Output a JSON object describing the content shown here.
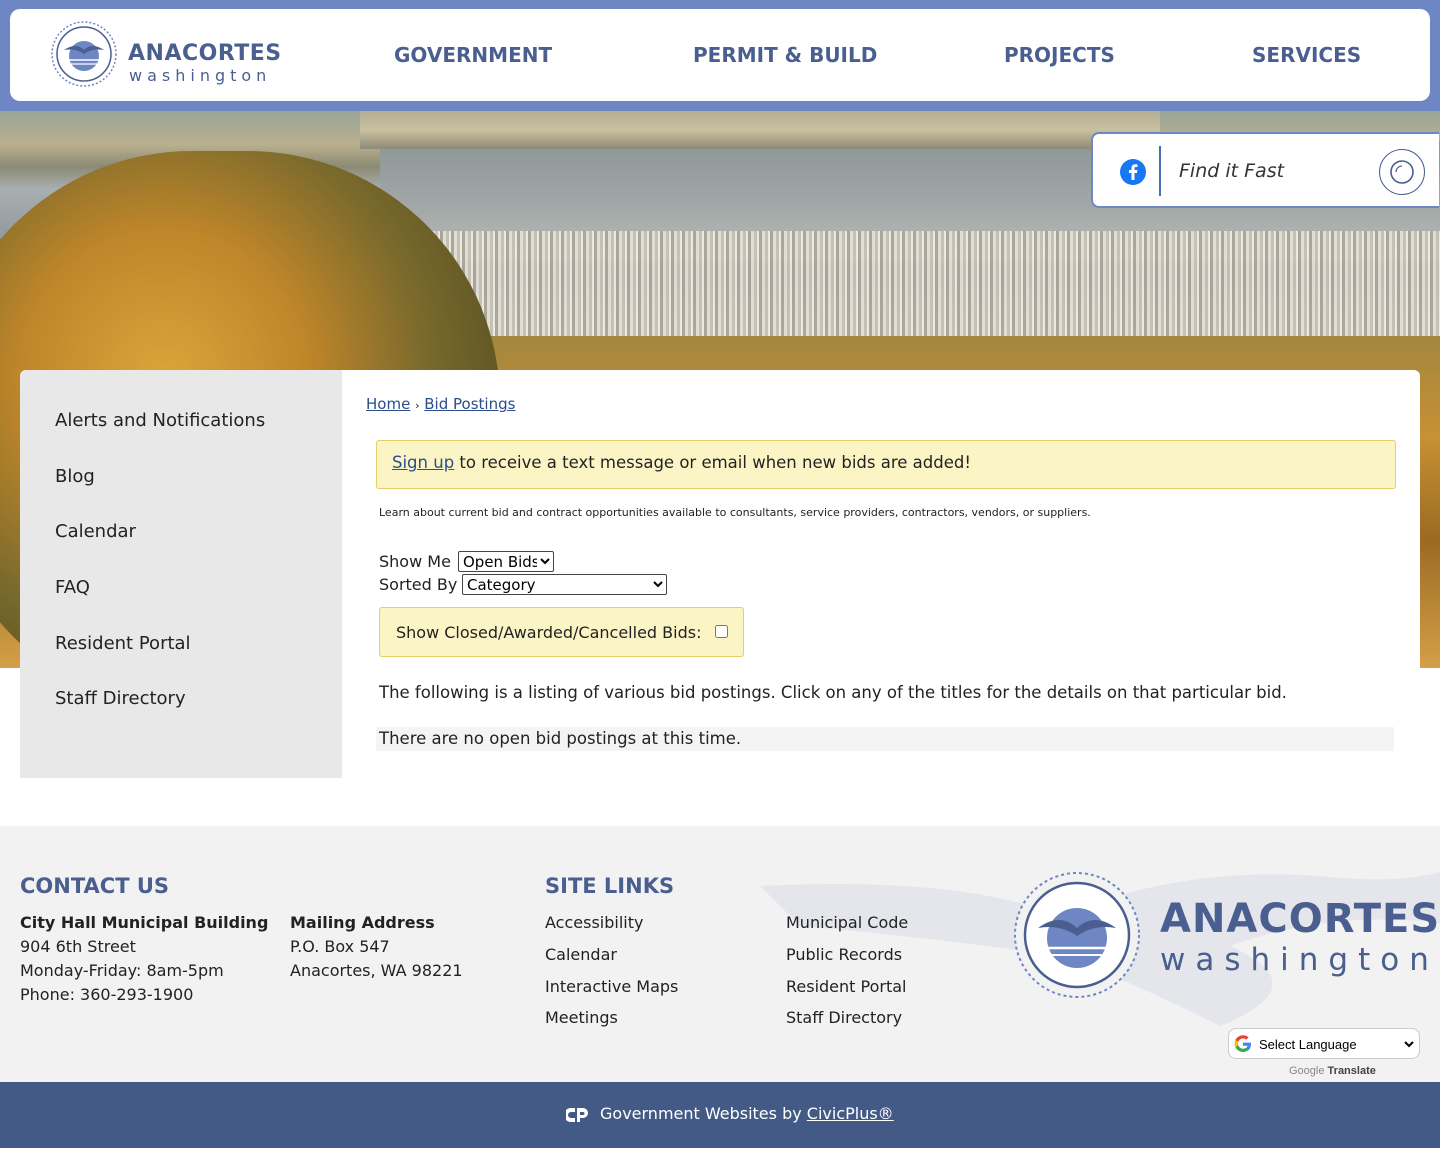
{
  "header": {
    "logo_title": "ANACORTES",
    "logo_sub": "washington",
    "nav": [
      "GOVERNMENT",
      "PERMIT & BUILD",
      "PROJECTS",
      "SERVICES"
    ]
  },
  "search": {
    "placeholder": "Find it Fast"
  },
  "sidebar": {
    "items": [
      "Alerts and Notifications",
      "Blog",
      "Calendar",
      "FAQ",
      "Resident Portal",
      "Staff Directory"
    ]
  },
  "breadcrumb": {
    "home": "Home",
    "sep": "›",
    "current": "Bid Postings"
  },
  "notice": {
    "link": "Sign up",
    "text": " to receive a text message or email when new bids are added!"
  },
  "description": "Learn about current bid and contract opportunities available to consultants, service providers, contractors, vendors, or suppliers.",
  "filters": {
    "show_label": "Show Me",
    "show_value": "Open Bids",
    "sort_label": "Sorted By",
    "sort_value": "Category",
    "closed_label": "Show Closed/Awarded/Cancelled Bids:"
  },
  "listing_text": "The following is a listing of various bid postings. Click on any of the titles for the details on that particular bid.",
  "no_postings": "There are no open bid postings at this time.",
  "footer": {
    "contact_heading": "CONTACT US",
    "city_hall": {
      "title": "City Hall Municipal Building",
      "street": "904 6th Street",
      "hours": "Monday-Friday: 8am-5pm",
      "phone": "Phone: 360-293-1900"
    },
    "mailing": {
      "title": "Mailing Address",
      "box": "P.O. Box 547",
      "city": "Anacortes, WA 98221"
    },
    "links_heading": "SITE LINKS",
    "links_col1": [
      "Accessibility",
      "Calendar",
      "Interactive Maps",
      "Meetings"
    ],
    "links_col2": [
      "Municipal Code",
      "Public Records",
      "Resident Portal",
      "Staff Directory"
    ],
    "logo_title": "ANACORTES",
    "logo_sub": "washington",
    "translate_label": "Select Language",
    "powered_google": "Google",
    "powered_translate": "Translate"
  },
  "bottom": {
    "text": "Government Websites by ",
    "link": "CivicPlus®"
  },
  "colors": {
    "brand": "#4a5f8f",
    "accent": "#6e86c4",
    "notice_bg": "#fbf5c6",
    "bar": "#435a86"
  }
}
